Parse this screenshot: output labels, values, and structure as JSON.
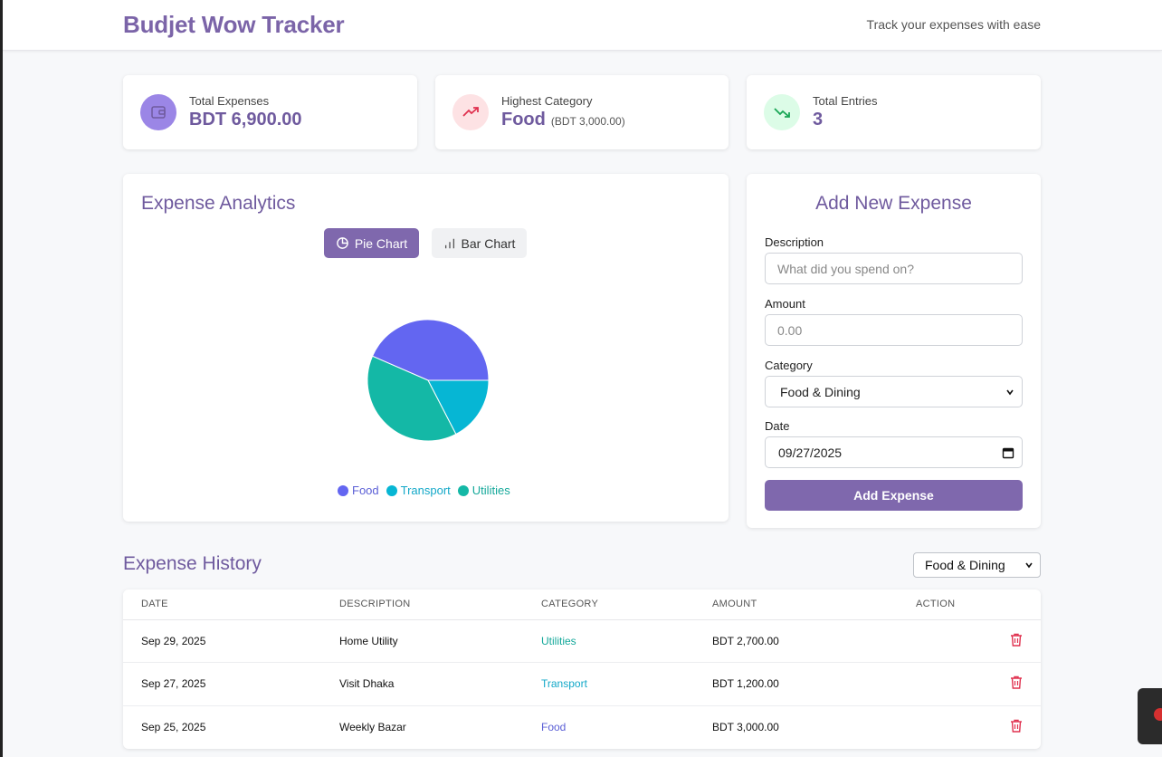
{
  "header": {
    "title": "Budjet Wow Tracker",
    "tagline": "Track your expenses with ease"
  },
  "stats": {
    "total_expenses": {
      "label": "Total Expenses",
      "value": "BDT 6,900.00",
      "icon": "wallet-icon",
      "color": "#9b86e6"
    },
    "highest_category": {
      "label": "Highest Category",
      "value": "Food",
      "sub": "(BDT 3,000.00)",
      "icon": "trending-up-icon",
      "color": "#e0314f"
    },
    "total_entries": {
      "label": "Total Entries",
      "value": "3",
      "icon": "trending-down-icon",
      "color": "#1aa656"
    }
  },
  "analytics": {
    "title": "Expense Analytics",
    "pie_button": "Pie Chart",
    "bar_button": "Bar Chart",
    "active_view": "pie"
  },
  "chart_data": {
    "type": "pie",
    "labels": [
      "Food",
      "Transport",
      "Utilities"
    ],
    "values": [
      3000,
      1200,
      2700
    ],
    "colors": [
      "#6366f1",
      "#06b6d4",
      "#14b8a6"
    ],
    "legend_position": "bottom"
  },
  "form": {
    "title": "Add New Expense",
    "description_label": "Description",
    "description_placeholder": "What did you spend on?",
    "amount_label": "Amount",
    "amount_placeholder": "0.00",
    "category_label": "Category",
    "category_value": "Food & Dining",
    "date_label": "Date",
    "date_value": "09/27/2025",
    "submit_label": "Add Expense"
  },
  "history": {
    "title": "Expense History",
    "filter_value": "Food & Dining",
    "columns": [
      "DATE",
      "DESCRIPTION",
      "CATEGORY",
      "AMOUNT",
      "ACTION"
    ],
    "rows": [
      {
        "date": "Sep 29, 2025",
        "description": "Home Utility",
        "category": "Utilities",
        "amount": "BDT 2,700.00"
      },
      {
        "date": "Sep 27, 2025",
        "description": "Visit Dhaka",
        "category": "Transport",
        "amount": "BDT 1,200.00"
      },
      {
        "date": "Sep 25, 2025",
        "description": "Weekly Bazar",
        "category": "Food",
        "amount": "BDT 3,000.00"
      }
    ]
  },
  "colors": {
    "brand": "#7b64a8",
    "button": "#7f68ad",
    "delete": "#e0314f"
  }
}
